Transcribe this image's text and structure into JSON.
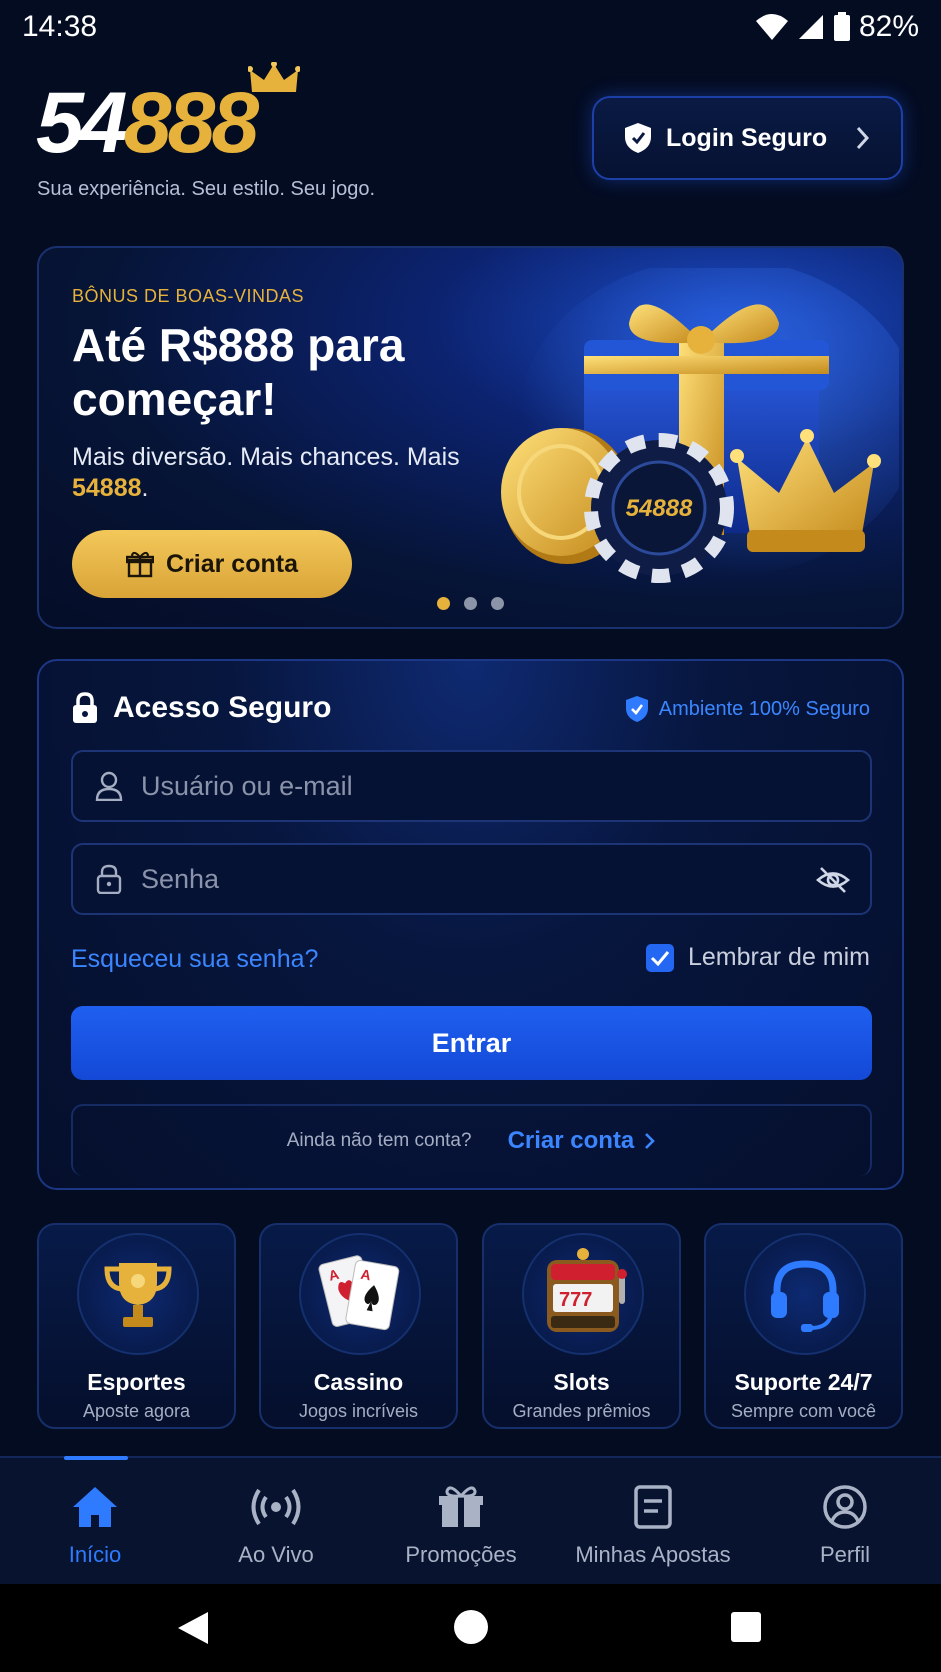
{
  "status_bar": {
    "time": "14:38",
    "battery": "82%"
  },
  "header": {
    "logo_white": "54",
    "logo_gold": "888",
    "tagline": "Sua experiência. Seu estilo. Seu jogo.",
    "login_button": "Login Seguro"
  },
  "banner": {
    "kicker": "BÔNUS DE BOAS-VINDAS",
    "title": "Até R$888 para começar!",
    "subtitle_prefix": "Mais diversão. Mais chances. Mais ",
    "subtitle_brand": "54888",
    "subtitle_suffix": ".",
    "cta": "Criar conta",
    "chip_text": "54888",
    "slides": 3,
    "active_slide": 1
  },
  "login": {
    "title": "Acesso Seguro",
    "secure_badge": "Ambiente 100% Seguro",
    "username_placeholder": "Usuário ou e-mail",
    "password_placeholder": "Senha",
    "forgot": "Esqueceu sua senha?",
    "remember": "Lembrar de mim",
    "remember_checked": true,
    "submit": "Entrar",
    "signup_question": "Ainda não tem conta?",
    "signup_link": "Criar conta"
  },
  "categories": [
    {
      "title": "Esportes",
      "subtitle": "Aposte agora",
      "icon": "trophy-icon"
    },
    {
      "title": "Cassino",
      "subtitle": "Jogos incríveis",
      "icon": "cards-icon"
    },
    {
      "title": "Slots",
      "subtitle": "Grandes prêmios",
      "icon": "slot-machine-icon"
    },
    {
      "title": "Suporte 24/7",
      "subtitle": "Sempre com você",
      "icon": "headset-icon"
    }
  ],
  "bottom_nav": [
    {
      "label": "Início",
      "icon": "home-icon",
      "active": true
    },
    {
      "label": "Ao Vivo",
      "icon": "live-icon",
      "active": false
    },
    {
      "label": "Promoções",
      "icon": "gift-icon",
      "active": false
    },
    {
      "label": "Minhas Apostas",
      "icon": "bets-icon",
      "active": false
    },
    {
      "label": "Perfil",
      "icon": "profile-icon",
      "active": false
    }
  ],
  "colors": {
    "background": "#040c22",
    "gold": "#e6b23b",
    "accent_blue": "#2e7bff",
    "primary_button": "#1f5ff0"
  }
}
